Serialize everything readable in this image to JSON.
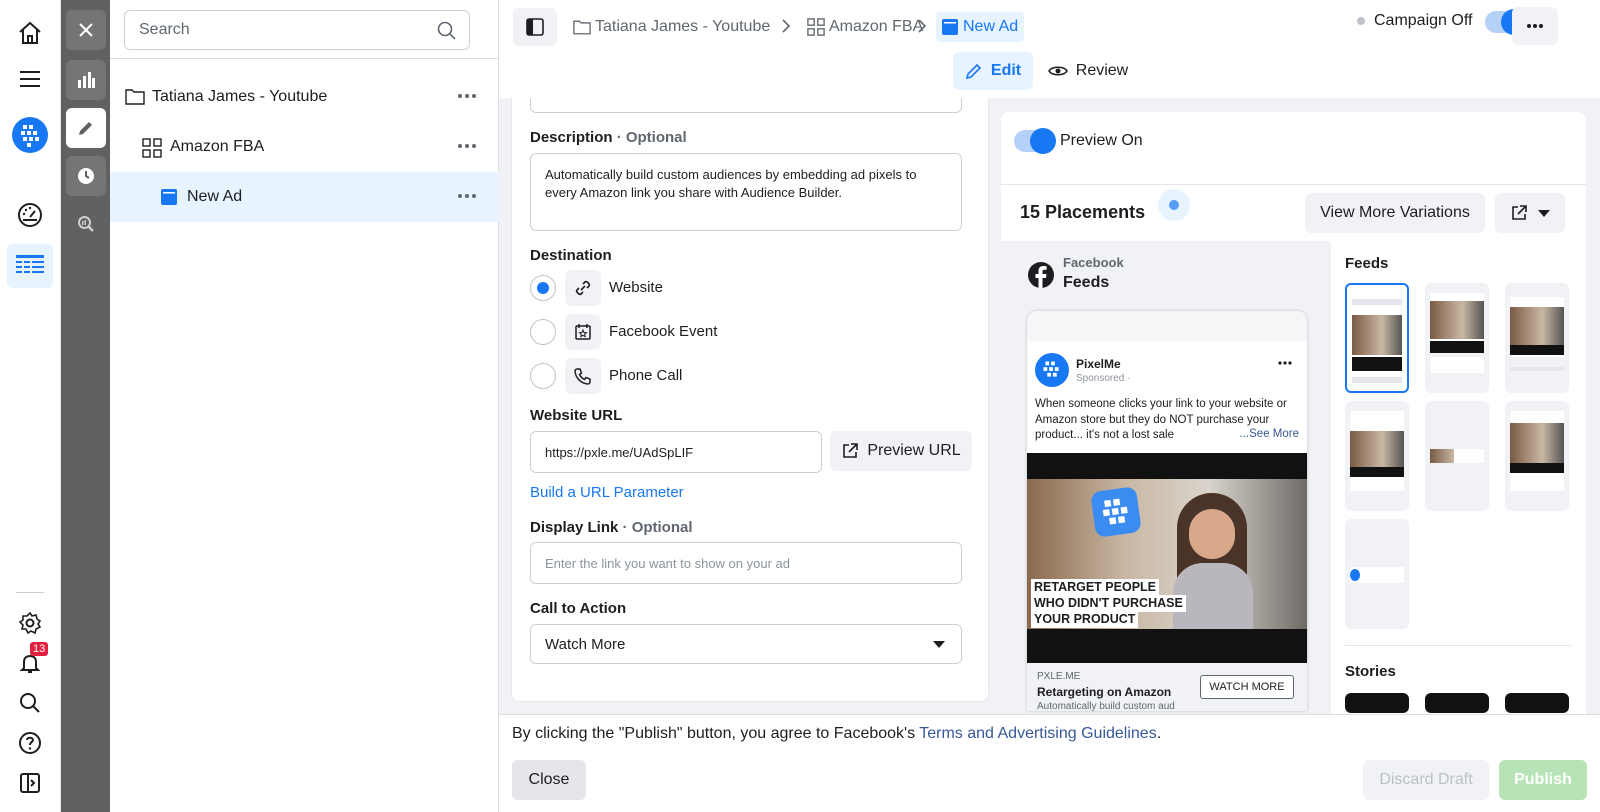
{
  "search": {
    "placeholder": "Search"
  },
  "tree": {
    "items": [
      {
        "label": "Tatiana James - Youtube"
      },
      {
        "label": "Amazon FBA"
      },
      {
        "label": "New Ad"
      }
    ]
  },
  "rail": {
    "notification_count": "13"
  },
  "breadcrumb": {
    "items": [
      {
        "label": "Tatiana James - Youtube"
      },
      {
        "label": "Amazon FBA"
      },
      {
        "label": "New Ad"
      }
    ]
  },
  "campaign": {
    "status_label": "Campaign Off"
  },
  "mode_tabs": {
    "edit": "Edit",
    "review": "Review"
  },
  "form": {
    "description_label": "Description",
    "optional": "· Optional",
    "description_value": "Automatically build custom audiences by embedding ad pixels to every Amazon link you share with Audience Builder.",
    "destination_label": "Destination",
    "destinations": [
      {
        "label": "Website",
        "selected": true
      },
      {
        "label": "Facebook Event",
        "selected": false
      },
      {
        "label": "Phone Call",
        "selected": false
      }
    ],
    "website_url_label": "Website URL",
    "website_url_value": "https://pxle.me/UAdSpLIF",
    "preview_url_button": "Preview URL",
    "build_param_link": "Build a URL Parameter",
    "display_link_label": "Display Link",
    "display_link_placeholder": "Enter the link you want to show on your ad",
    "cta_label": "Call to Action",
    "cta_value": "Watch More"
  },
  "preview": {
    "toggle_label": "Preview On",
    "placements_title": "15 Placements",
    "view_more_button": "View More Variations",
    "platform": "Facebook",
    "placement": "Feeds",
    "feeds_heading": "Feeds",
    "stories_heading": "Stories",
    "ad": {
      "page_name": "PixelMe",
      "sponsored": "Sponsored ·",
      "body": "When someone clicks your link to your website or Amazon store but they do NOT purchase your product... it's not a lost sale",
      "see_more": "...See More",
      "overlay_line1": "RETARGET PEOPLE",
      "overlay_line2": "WHO DIDN'T PURCHASE",
      "overlay_line3": "YOUR PRODUCT",
      "domain": "PXLE.ME",
      "headline": "Retargeting on Amazon",
      "link_desc": "Automatically build custom aud",
      "cta_button": "WATCH MORE"
    }
  },
  "footer": {
    "agreement": "By clicking the \"Publish\" button, you agree to Facebook's ",
    "terms_link": "Terms and Advertising Guidelines",
    "period": ".",
    "close_button": "Close",
    "discard_button": "Discard Draft",
    "publish_button": "Publish"
  },
  "colors": {
    "accent": "#1877f2",
    "toolbar_bg": "#616161",
    "selected_row": "#e7f3ff",
    "publish_disabled": "#b7e4b7"
  }
}
